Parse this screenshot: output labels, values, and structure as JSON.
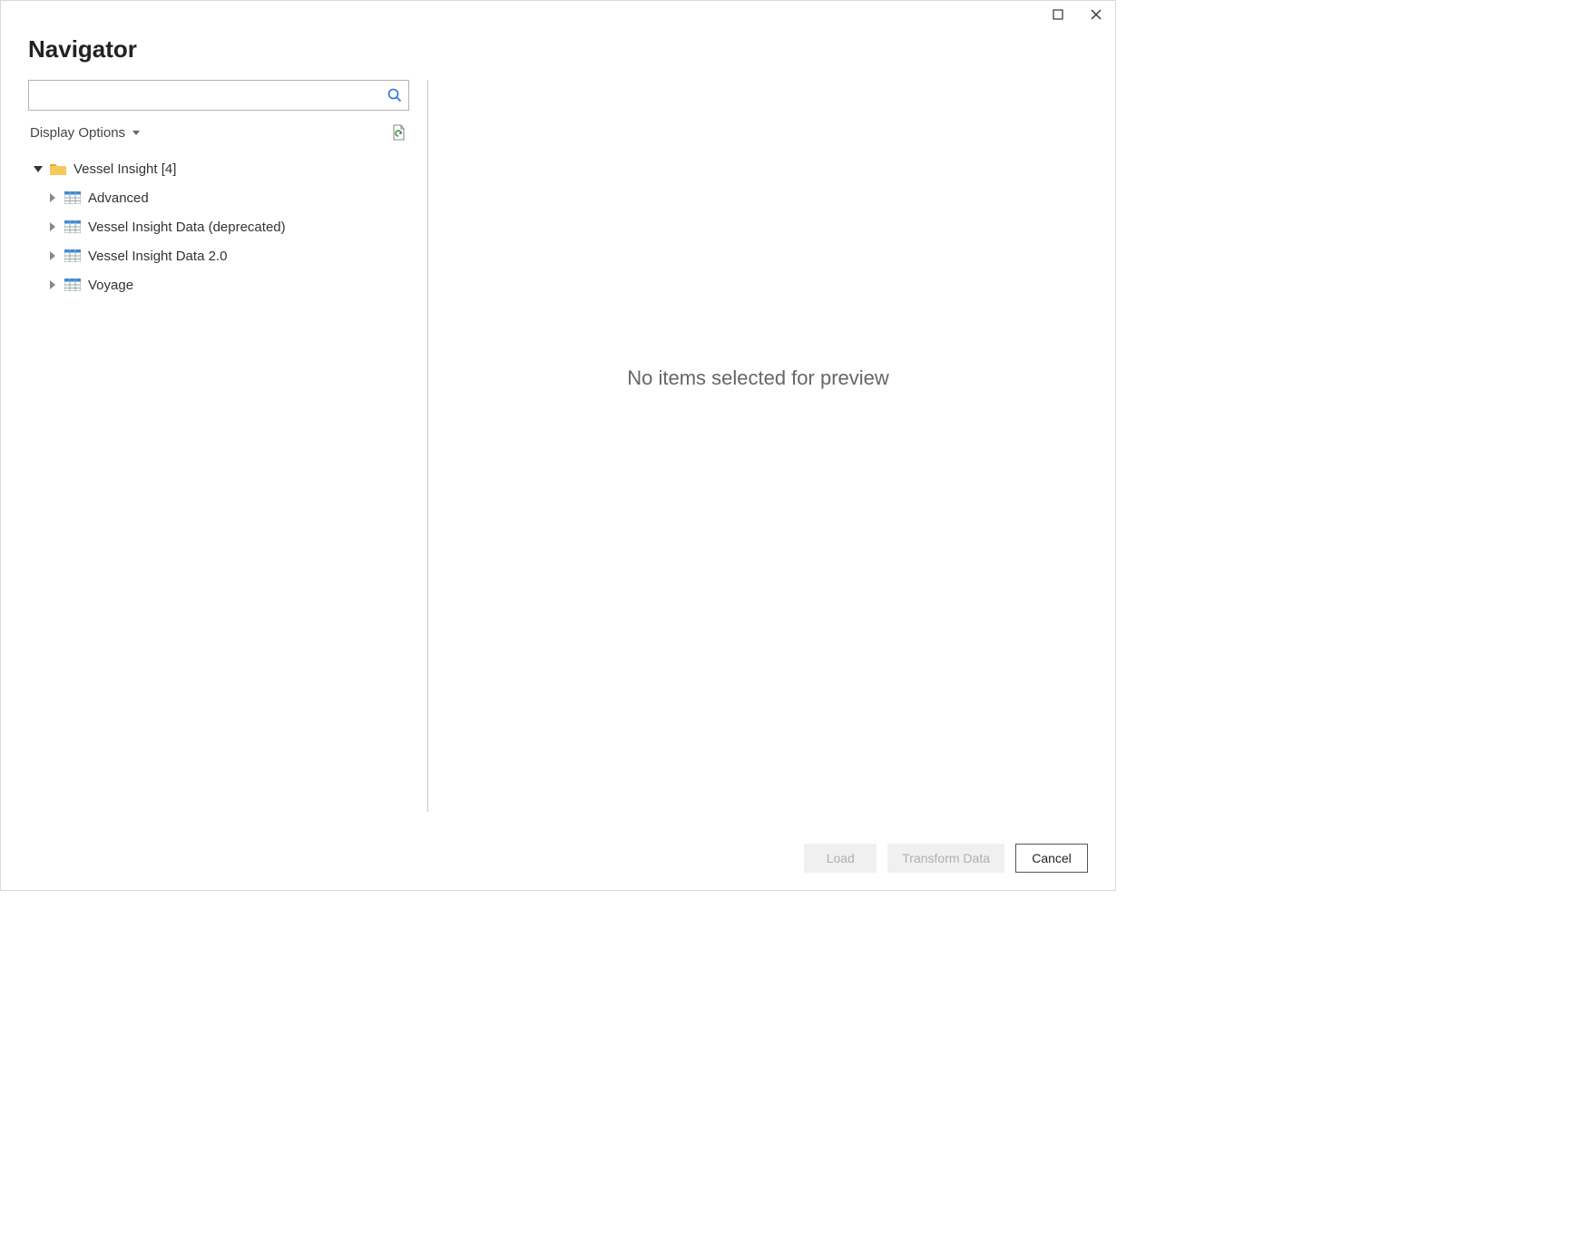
{
  "header": {
    "title": "Navigator"
  },
  "search": {
    "placeholder": "",
    "value": ""
  },
  "options": {
    "display_label": "Display Options"
  },
  "tree": {
    "root": {
      "label": "Vessel Insight [4]",
      "expanded": true
    },
    "children": [
      {
        "label": "Advanced"
      },
      {
        "label": "Vessel Insight Data (deprecated)"
      },
      {
        "label": "Vessel Insight Data 2.0"
      },
      {
        "label": "Voyage"
      }
    ]
  },
  "preview": {
    "empty_message": "No items selected for preview"
  },
  "footer": {
    "load_label": "Load",
    "transform_label": "Transform Data",
    "cancel_label": "Cancel"
  }
}
